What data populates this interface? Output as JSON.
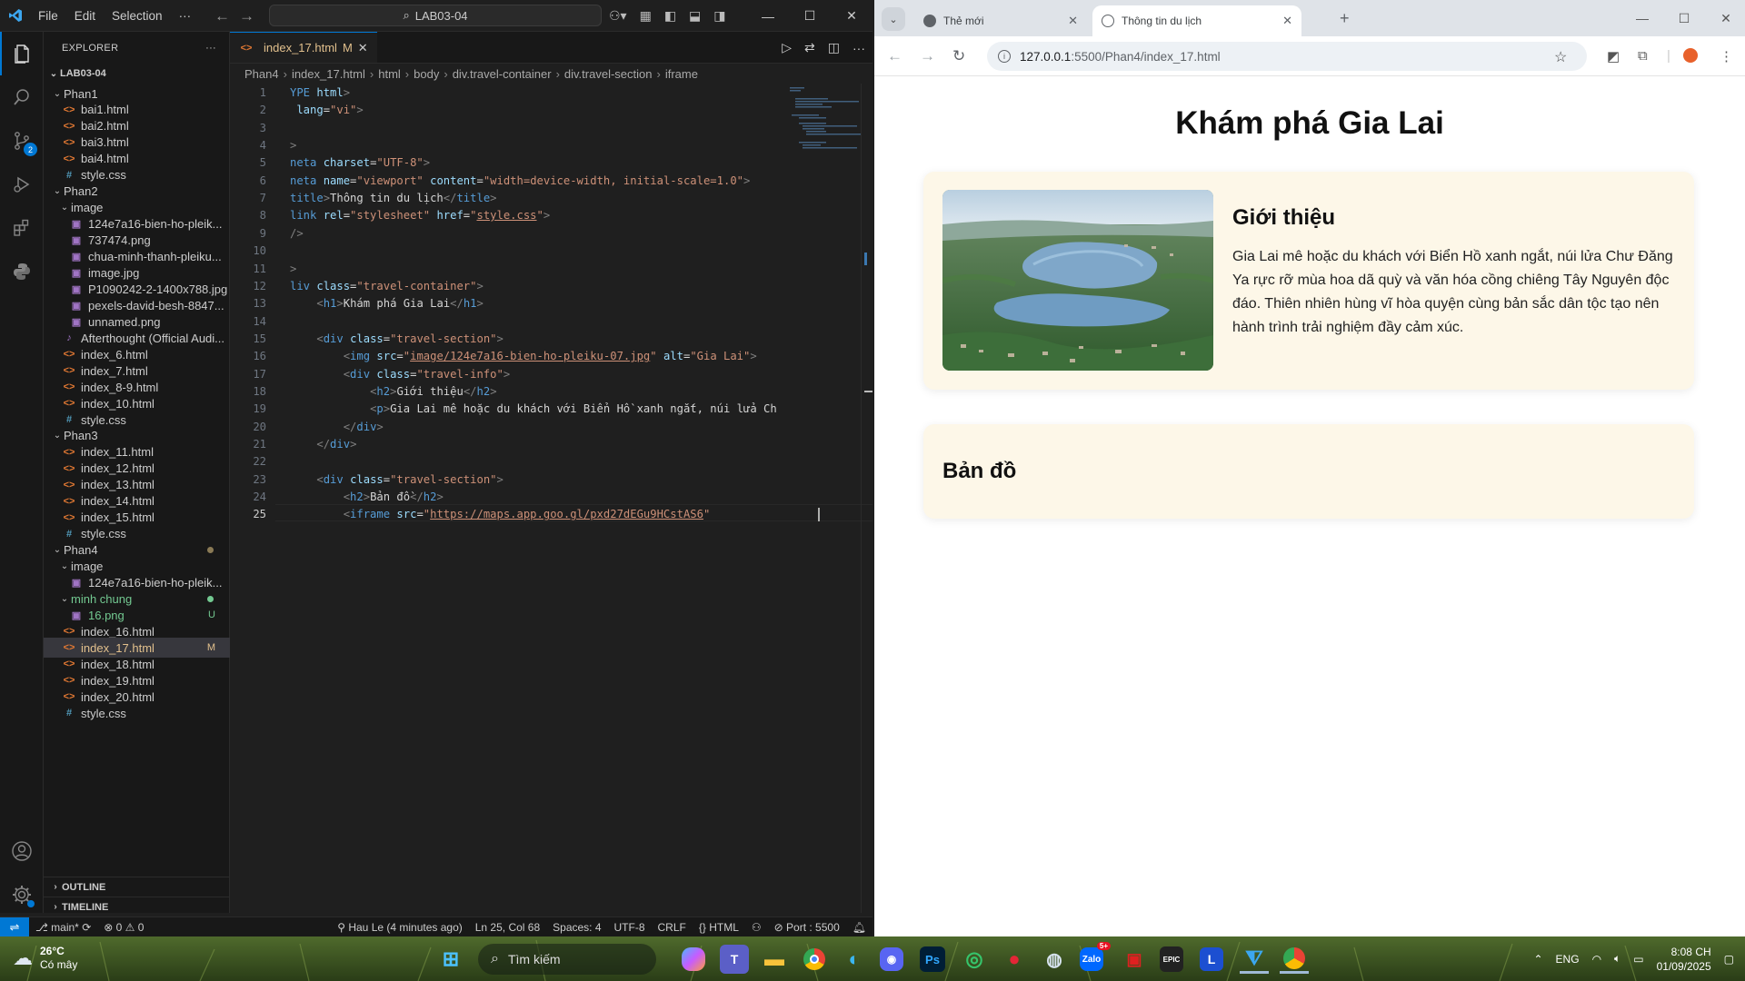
{
  "vscode": {
    "menu": [
      "File",
      "Edit",
      "Selection",
      "···"
    ],
    "search": "LAB03-04",
    "explorer_title": "EXPLORER",
    "root_folder": "LAB03-04",
    "tree": [
      {
        "label": "Phan1",
        "type": "folder",
        "indent": 1
      },
      {
        "label": "bai1.html",
        "type": "html",
        "indent": 2
      },
      {
        "label": "bai2.html",
        "type": "html",
        "indent": 2
      },
      {
        "label": "bai3.html",
        "type": "html",
        "indent": 2
      },
      {
        "label": "bai4.html",
        "type": "html",
        "indent": 2
      },
      {
        "label": "style.css",
        "type": "css",
        "indent": 2
      },
      {
        "label": "Phan2",
        "type": "folder",
        "indent": 1
      },
      {
        "label": "image",
        "type": "folder",
        "indent": 2
      },
      {
        "label": "124e7a16-bien-ho-pleik...",
        "type": "img",
        "indent": 3
      },
      {
        "label": "737474.png",
        "type": "img",
        "indent": 3
      },
      {
        "label": "chua-minh-thanh-pleiku...",
        "type": "img",
        "indent": 3
      },
      {
        "label": "image.jpg",
        "type": "img",
        "indent": 3
      },
      {
        "label": "P1090242-2-1400x788.jpg",
        "type": "img",
        "indent": 3
      },
      {
        "label": "pexels-david-besh-8847...",
        "type": "img",
        "indent": 3
      },
      {
        "label": "unnamed.png",
        "type": "img",
        "indent": 3
      },
      {
        "label": "Afterthought (Official Audi...",
        "type": "audio",
        "indent": 2
      },
      {
        "label": "index_6.html",
        "type": "html",
        "indent": 2
      },
      {
        "label": "index_7.html",
        "type": "html",
        "indent": 2
      },
      {
        "label": "index_8-9.html",
        "type": "html",
        "indent": 2
      },
      {
        "label": "index_10.html",
        "type": "html",
        "indent": 2
      },
      {
        "label": "style.css",
        "type": "css",
        "indent": 2
      },
      {
        "label": "Phan3",
        "type": "folder",
        "indent": 1
      },
      {
        "label": "index_11.html",
        "type": "html",
        "indent": 2
      },
      {
        "label": "index_12.html",
        "type": "html",
        "indent": 2
      },
      {
        "label": "index_13.html",
        "type": "html",
        "indent": 2
      },
      {
        "label": "index_14.html",
        "type": "html",
        "indent": 2
      },
      {
        "label": "index_15.html",
        "type": "html",
        "indent": 2
      },
      {
        "label": "style.css",
        "type": "css",
        "indent": 2
      },
      {
        "label": "Phan4",
        "type": "folder",
        "indent": 1,
        "dot": true
      },
      {
        "label": "image",
        "type": "folder",
        "indent": 2
      },
      {
        "label": "124e7a16-bien-ho-pleik...",
        "type": "img",
        "indent": 3
      },
      {
        "label": "minh chung",
        "type": "folder",
        "indent": 2,
        "dot": true,
        "green": true
      },
      {
        "label": "16.png",
        "type": "img",
        "indent": 3,
        "badge": "U",
        "green": true
      },
      {
        "label": "index_16.html",
        "type": "html",
        "indent": 2
      },
      {
        "label": "index_17.html",
        "type": "html",
        "indent": 2,
        "badge": "M",
        "selected": true
      },
      {
        "label": "index_18.html",
        "type": "html",
        "indent": 2
      },
      {
        "label": "index_19.html",
        "type": "html",
        "indent": 2
      },
      {
        "label": "index_20.html",
        "type": "html",
        "indent": 2
      },
      {
        "label": "style.css",
        "type": "css",
        "indent": 2
      }
    ],
    "outline_label": "OUTLINE",
    "timeline_label": "TIMELINE",
    "tab": {
      "name": "index_17.html",
      "status": "M"
    },
    "breadcrumbs": [
      "Phan4",
      "index_17.html",
      "html",
      "body",
      "div.travel-container",
      "div.travel-section",
      "iframe"
    ],
    "code_lines": [
      {
        "n": "1",
        "segs": [
          [
            "t-tag",
            "YPE "
          ],
          [
            "t-at",
            "html"
          ],
          [
            "t-br",
            ">"
          ]
        ]
      },
      {
        "n": "2",
        "segs": [
          [
            "t-at",
            " lang"
          ],
          [
            "t-tx",
            "="
          ],
          [
            "t-st",
            "\"vi\""
          ],
          [
            "t-br",
            ">"
          ]
        ]
      },
      {
        "n": "3",
        "segs": []
      },
      {
        "n": "4",
        "segs": [
          [
            "t-br",
            ">"
          ]
        ]
      },
      {
        "n": "5",
        "segs": [
          [
            "t-tag",
            "neta "
          ],
          [
            "t-at",
            "charset"
          ],
          [
            "t-tx",
            "="
          ],
          [
            "t-st",
            "\"UTF-8\""
          ],
          [
            "t-br",
            ">"
          ]
        ]
      },
      {
        "n": "6",
        "segs": [
          [
            "t-tag",
            "neta "
          ],
          [
            "t-at",
            "name"
          ],
          [
            "t-tx",
            "="
          ],
          [
            "t-st",
            "\"viewport\" "
          ],
          [
            "t-at",
            "content"
          ],
          [
            "t-tx",
            "="
          ],
          [
            "t-st",
            "\"width=device-width, initial-scale=1.0\""
          ],
          [
            "t-br",
            ">"
          ]
        ]
      },
      {
        "n": "7",
        "segs": [
          [
            "t-tag",
            "title"
          ],
          [
            "t-br",
            ">"
          ],
          [
            "t-tx",
            "Thông tin du lịch"
          ],
          [
            "t-br",
            "</"
          ],
          [
            "t-tag",
            "title"
          ],
          [
            "t-br",
            ">"
          ]
        ]
      },
      {
        "n": "8",
        "segs": [
          [
            "t-tag",
            "link "
          ],
          [
            "t-at",
            "rel"
          ],
          [
            "t-tx",
            "="
          ],
          [
            "t-st",
            "\"stylesheet\" "
          ],
          [
            "t-at",
            "href"
          ],
          [
            "t-tx",
            "="
          ],
          [
            "t-st",
            "\""
          ],
          [
            "t-st t-u",
            "style.css"
          ],
          [
            "t-st",
            "\""
          ],
          [
            "t-br",
            ">"
          ]
        ]
      },
      {
        "n": "9",
        "segs": [
          [
            "t-br",
            "/>"
          ]
        ]
      },
      {
        "n": "10",
        "segs": []
      },
      {
        "n": "11",
        "segs": [
          [
            "t-br",
            ">"
          ]
        ]
      },
      {
        "n": "12",
        "segs": [
          [
            "t-tag",
            "liv "
          ],
          [
            "t-at",
            "class"
          ],
          [
            "t-tx",
            "="
          ],
          [
            "t-st",
            "\"travel-container\""
          ],
          [
            "t-br",
            ">"
          ]
        ]
      },
      {
        "n": "13",
        "segs": [
          [
            "t-tx",
            "    "
          ],
          [
            "t-br",
            "<"
          ],
          [
            "t-tag",
            "h1"
          ],
          [
            "t-br",
            ">"
          ],
          [
            "t-tx",
            "Khám phá Gia Lai"
          ],
          [
            "t-br",
            "</"
          ],
          [
            "t-tag",
            "h1"
          ],
          [
            "t-br",
            ">"
          ]
        ]
      },
      {
        "n": "14",
        "segs": []
      },
      {
        "n": "15",
        "segs": [
          [
            "t-tx",
            "    "
          ],
          [
            "t-br",
            "<"
          ],
          [
            "t-tag",
            "div "
          ],
          [
            "t-at",
            "class"
          ],
          [
            "t-tx",
            "="
          ],
          [
            "t-st",
            "\"travel-section\""
          ],
          [
            "t-br",
            ">"
          ]
        ]
      },
      {
        "n": "16",
        "segs": [
          [
            "t-tx",
            "        "
          ],
          [
            "t-br",
            "<"
          ],
          [
            "t-tag",
            "img "
          ],
          [
            "t-at",
            "src"
          ],
          [
            "t-tx",
            "="
          ],
          [
            "t-st",
            "\""
          ],
          [
            "t-st t-u",
            "image/124e7a16-bien-ho-pleiku-07.jpg"
          ],
          [
            "t-st",
            "\" "
          ],
          [
            "t-at",
            "alt"
          ],
          [
            "t-tx",
            "="
          ],
          [
            "t-st",
            "\"Gia Lai\""
          ],
          [
            "t-br",
            ">"
          ]
        ]
      },
      {
        "n": "17",
        "segs": [
          [
            "t-tx",
            "        "
          ],
          [
            "t-br",
            "<"
          ],
          [
            "t-tag",
            "div "
          ],
          [
            "t-at",
            "class"
          ],
          [
            "t-tx",
            "="
          ],
          [
            "t-st",
            "\"travel-info\""
          ],
          [
            "t-br",
            ">"
          ]
        ]
      },
      {
        "n": "18",
        "segs": [
          [
            "t-tx",
            "            "
          ],
          [
            "t-br",
            "<"
          ],
          [
            "t-tag",
            "h2"
          ],
          [
            "t-br",
            ">"
          ],
          [
            "t-tx",
            "Giới thiệu"
          ],
          [
            "t-br",
            "</"
          ],
          [
            "t-tag",
            "h2"
          ],
          [
            "t-br",
            ">"
          ]
        ]
      },
      {
        "n": "19",
        "segs": [
          [
            "t-tx",
            "            "
          ],
          [
            "t-br",
            "<"
          ],
          [
            "t-tag",
            "p"
          ],
          [
            "t-br",
            ">"
          ],
          [
            "t-tx",
            "Gia Lai mê hoặc du khách với Biển Hồ xanh ngắt, núi lửa Ch"
          ]
        ]
      },
      {
        "n": "20",
        "segs": [
          [
            "t-tx",
            "        "
          ],
          [
            "t-br",
            "</"
          ],
          [
            "t-tag",
            "div"
          ],
          [
            "t-br",
            ">"
          ]
        ]
      },
      {
        "n": "21",
        "segs": [
          [
            "t-tx",
            "    "
          ],
          [
            "t-br",
            "</"
          ],
          [
            "t-tag",
            "div"
          ],
          [
            "t-br",
            ">"
          ]
        ]
      },
      {
        "n": "22",
        "segs": []
      },
      {
        "n": "23",
        "segs": [
          [
            "t-tx",
            "    "
          ],
          [
            "t-br",
            "<"
          ],
          [
            "t-tag",
            "div "
          ],
          [
            "t-at",
            "class"
          ],
          [
            "t-tx",
            "="
          ],
          [
            "t-st",
            "\"travel-section\""
          ],
          [
            "t-br",
            ">"
          ]
        ]
      },
      {
        "n": "24",
        "segs": [
          [
            "t-tx",
            "        "
          ],
          [
            "t-br",
            "<"
          ],
          [
            "t-tag",
            "h2"
          ],
          [
            "t-br",
            ">"
          ],
          [
            "t-tx",
            "Bản đồ"
          ],
          [
            "t-br",
            "</"
          ],
          [
            "t-tag",
            "h2"
          ],
          [
            "t-br",
            ">"
          ]
        ]
      },
      {
        "n": "25",
        "segs": [
          [
            "t-tx",
            "        "
          ],
          [
            "t-br",
            "<"
          ],
          [
            "t-tag",
            "iframe "
          ],
          [
            "t-at",
            "src"
          ],
          [
            "t-tx",
            "="
          ],
          [
            "t-st",
            "\""
          ],
          [
            "t-st t-u",
            "https://maps.app.goo.gl/pxd27dEGu9HCstAS6"
          ],
          [
            "t-st",
            "\""
          ]
        ]
      }
    ],
    "status": {
      "branch": "main*",
      "problems": "0",
      "warnings": "0",
      "blame": "Hau Le (4 minutes ago)",
      "position": "Ln 25, Col 68",
      "spaces": "Spaces: 4",
      "encoding": "UTF-8",
      "eol": "CRLF",
      "language": "HTML",
      "port": "Port : 5500"
    }
  },
  "browser": {
    "tabs": [
      {
        "title": "Thẻ mới",
        "active": false
      },
      {
        "title": "Thông tin du lịch",
        "active": true
      }
    ],
    "url_host": "127.0.0.1",
    "url_path": ":5500/Phan4/index_17.html",
    "page": {
      "title": "Khám phá Gia Lai",
      "section1_heading": "Giới thiệu",
      "section1_text": "Gia Lai mê hoặc du khách với Biển Hồ xanh ngắt, núi lửa Chư Đăng Ya rực rỡ mùa hoa dã quỳ và văn hóa cồng chiêng Tây Nguyên độc đáo. Thiên nhiên hùng vĩ hòa quyện cùng bản sắc dân tộc tạo nên hành trình trải nghiệm đầy cảm xúc.",
      "section1_img_alt": "Gia Lai",
      "section2_heading": "Bản đồ"
    }
  },
  "taskbar": {
    "temperature": "26°C",
    "weather": "Có mây",
    "search_placeholder": "Tìm kiếm",
    "language": "ENG",
    "time": "8:08 CH",
    "date": "01/09/2025",
    "zalo_badge": "5+"
  }
}
